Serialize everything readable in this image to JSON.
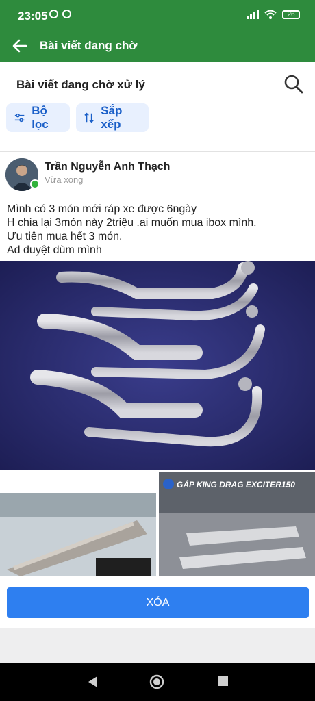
{
  "status_bar": {
    "time": "23:05",
    "battery": "26",
    "icons": [
      "alarm-icon",
      "app-notification-icon",
      "signal-icon",
      "wifi-icon",
      "battery-icon"
    ]
  },
  "appbar": {
    "title": "Bài viết đang chờ",
    "background": "#2e8b3d"
  },
  "section": {
    "title": "Bài viết đang chờ xử lý"
  },
  "chips": {
    "filter_label": "Bộ lọc",
    "sort_label": "Sắp xếp"
  },
  "post": {
    "author": "Trần Nguyễn Anh Thạch",
    "time": "Vừa xong",
    "lines": [
      "Mình có 3 món mới ráp xe được 6ngày",
      "H chia lại 3món này 2triệu .ai muốn mua ibox mình.",
      "Ưu tiên mua hết 3 món.",
      "Ad duyệt dùm mình"
    ],
    "photo_right_caption": "GẮP KING DRAG EXCITER150"
  },
  "actions": {
    "delete_label": "XÓA",
    "delete_color": "#2e7ff0"
  }
}
